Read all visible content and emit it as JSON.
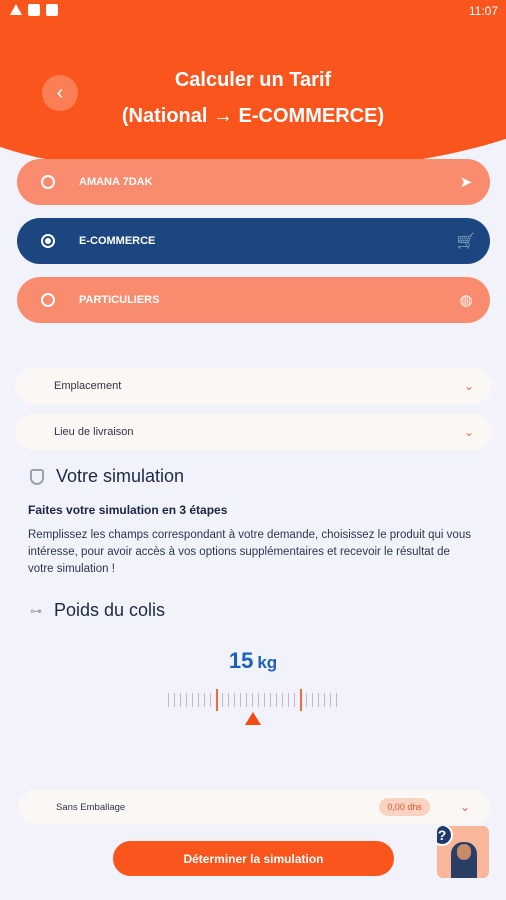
{
  "status_bar": {
    "time": "11:07"
  },
  "header": {
    "title_line1": "Calculer un Tarif",
    "title_line2": "(National → E-COMMERCE)"
  },
  "options": [
    {
      "label": "AMANA 7DAK",
      "selected": false,
      "icon": "send-icon"
    },
    {
      "label": "E-COMMERCE",
      "selected": true,
      "icon": "cart-icon"
    },
    {
      "label": "PARTICULIERS",
      "selected": false,
      "icon": "palette-icon"
    }
  ],
  "fields": {
    "emplacement": "Emplacement",
    "lieu": "Lieu de livraison"
  },
  "simulation": {
    "title": "Votre simulation",
    "subtitle": "Faites votre simulation en 3 étapes",
    "description": "Remplissez les champs correspondant à votre demande, choisissez le produit qui vous intéresse, pour avoir accès à  vos options supplémentaires et recevoir le résultat de votre simulation !"
  },
  "weight": {
    "title": "Poids du colis",
    "value": "15",
    "unit": "kg"
  },
  "packaging": {
    "label": "Sans Emballage",
    "price": "0,00 dhs"
  },
  "cta": {
    "label": "Déterminer la simulation"
  },
  "help": {
    "label": "?"
  }
}
